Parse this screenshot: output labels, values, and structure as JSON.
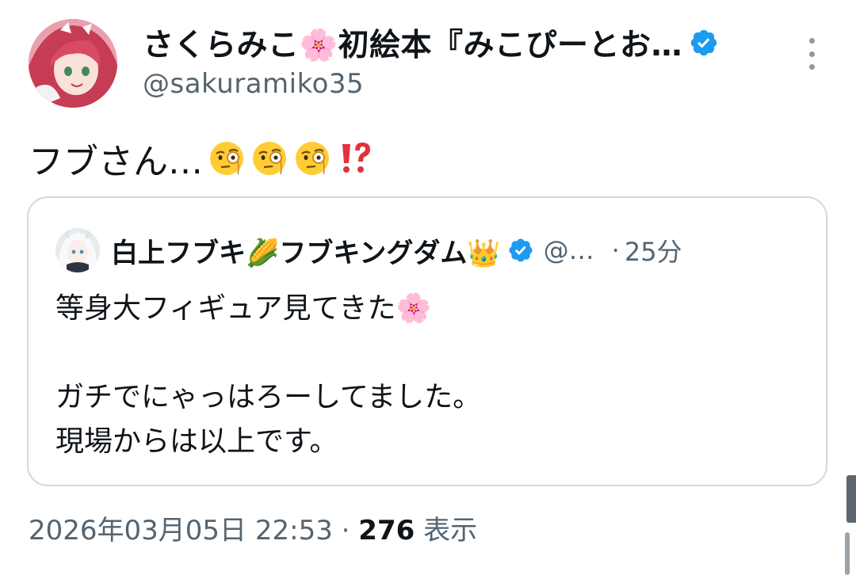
{
  "tweet": {
    "author": {
      "display_name": "さくらみこ🌸初絵本『みこぴーとお…",
      "handle": "@sakuramiko35",
      "verified": true,
      "avatar_icon": "avatar-image"
    },
    "text": "フブさん…",
    "text_emojis": [
      "monocle-face-emoji",
      "monocle-face-emoji",
      "monocle-face-emoji",
      "exclamation-question-emoji"
    ],
    "quote": {
      "author": {
        "display_name": "白上フブキ🌽フブキングダム👑",
        "handle": "@…",
        "separator": "·",
        "time": "25分",
        "verified": true
      },
      "lines": [
        "等身大フィギュア見てきた🌸",
        "",
        "ガチでにゃっはろーしてました。",
        "現場からは以上です。"
      ]
    },
    "meta": {
      "timestamp": "2026年03月05日 22:53",
      "separator": "·",
      "views_count": "276",
      "views_label": "表示"
    }
  },
  "colors": {
    "verified_blue": "#1d9bf0",
    "secondary_text": "#536471",
    "primary_text": "#0f1419",
    "border": "#cfd9de"
  }
}
